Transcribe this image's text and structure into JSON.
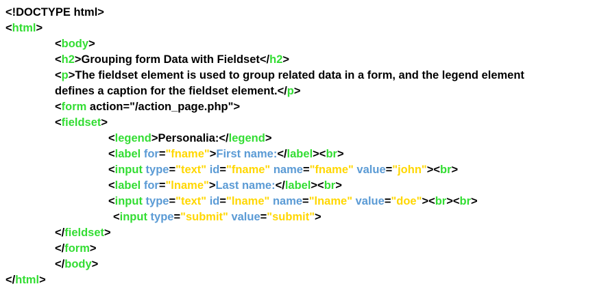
{
  "colors": {
    "text": "#000000",
    "tag": "#33dd33",
    "attr": "#5b9bd5",
    "value": "#ffd700"
  },
  "lines": [
    {
      "indent": 0,
      "tokens": [
        {
          "t": "<!DOCTYPE html>",
          "c": "text"
        }
      ]
    },
    {
      "indent": 0,
      "tokens": [
        {
          "t": "<",
          "c": "text"
        },
        {
          "t": "html",
          "c": "tag"
        },
        {
          "t": ">",
          "c": "text"
        }
      ]
    },
    {
      "indent": 1,
      "tokens": [
        {
          "t": "<",
          "c": "text"
        },
        {
          "t": "body",
          "c": "tag"
        },
        {
          "t": ">",
          "c": "text"
        }
      ]
    },
    {
      "indent": 1,
      "tokens": [
        {
          "t": "<",
          "c": "text"
        },
        {
          "t": "h2",
          "c": "tag"
        },
        {
          "t": ">Grouping form Data with Fieldset</",
          "c": "text"
        },
        {
          "t": "h2",
          "c": "tag"
        },
        {
          "t": ">",
          "c": "text"
        }
      ]
    },
    {
      "indent": 1,
      "tokens": [
        {
          "t": "<",
          "c": "text"
        },
        {
          "t": "p",
          "c": "tag"
        },
        {
          "t": ">The fieldset element is used to group related data in a form, and the legend element",
          "c": "text"
        }
      ]
    },
    {
      "indent": 1,
      "tokens": [
        {
          "t": "defines a caption for the fieldset element.</",
          "c": "text"
        },
        {
          "t": "p",
          "c": "tag"
        },
        {
          "t": ">",
          "c": "text"
        }
      ]
    },
    {
      "indent": 1,
      "tokens": [
        {
          "t": "<",
          "c": "text"
        },
        {
          "t": "form",
          "c": "tag"
        },
        {
          "t": " action=\"/action_page.php\">",
          "c": "text"
        }
      ]
    },
    {
      "indent": 1,
      "tokens": [
        {
          "t": "<",
          "c": "text"
        },
        {
          "t": "fieldset",
          "c": "tag"
        },
        {
          "t": ">",
          "c": "text"
        }
      ]
    },
    {
      "indent": 2,
      "tokens": [
        {
          "t": "<",
          "c": "text"
        },
        {
          "t": "legend",
          "c": "tag"
        },
        {
          "t": ">Personalia:</",
          "c": "text"
        },
        {
          "t": "legend",
          "c": "tag"
        },
        {
          "t": ">",
          "c": "text"
        }
      ]
    },
    {
      "indent": 2,
      "tokens": [
        {
          "t": "<",
          "c": "text"
        },
        {
          "t": "label",
          "c": "tag"
        },
        {
          "t": " for",
          "c": "attr"
        },
        {
          "t": "=",
          "c": "text"
        },
        {
          "t": "\"fname\"",
          "c": "val"
        },
        {
          "t": ">",
          "c": "text"
        },
        {
          "t": "First name:",
          "c": "attr"
        },
        {
          "t": "</",
          "c": "text"
        },
        {
          "t": "label",
          "c": "tag"
        },
        {
          "t": "><",
          "c": "text"
        },
        {
          "t": "br",
          "c": "tag"
        },
        {
          "t": ">",
          "c": "text"
        }
      ]
    },
    {
      "indent": 2,
      "tokens": [
        {
          "t": "<",
          "c": "text"
        },
        {
          "t": "input",
          "c": "tag"
        },
        {
          "t": " type",
          "c": "attr"
        },
        {
          "t": "=",
          "c": "text"
        },
        {
          "t": "\"text\"",
          "c": "val"
        },
        {
          "t": " id",
          "c": "attr"
        },
        {
          "t": "=",
          "c": "text"
        },
        {
          "t": "\"fname\"",
          "c": "val"
        },
        {
          "t": " name",
          "c": "attr"
        },
        {
          "t": "=",
          "c": "text"
        },
        {
          "t": "\"fname\"",
          "c": "val"
        },
        {
          "t": " value",
          "c": "attr"
        },
        {
          "t": "=",
          "c": "text"
        },
        {
          "t": "\"john\"",
          "c": "val"
        },
        {
          "t": "><",
          "c": "text"
        },
        {
          "t": "br",
          "c": "tag"
        },
        {
          "t": ">",
          "c": "text"
        }
      ]
    },
    {
      "indent": 2,
      "tokens": [
        {
          "t": "<",
          "c": "text"
        },
        {
          "t": "label",
          "c": "tag"
        },
        {
          "t": " for",
          "c": "attr"
        },
        {
          "t": "=",
          "c": "text"
        },
        {
          "t": "\"lname\"",
          "c": "val"
        },
        {
          "t": ">",
          "c": "text"
        },
        {
          "t": "Last name:",
          "c": "attr"
        },
        {
          "t": "</",
          "c": "text"
        },
        {
          "t": "label",
          "c": "tag"
        },
        {
          "t": "><",
          "c": "text"
        },
        {
          "t": "br",
          "c": "tag"
        },
        {
          "t": ">",
          "c": "text"
        }
      ]
    },
    {
      "indent": 2,
      "tokens": [
        {
          "t": "<",
          "c": "text"
        },
        {
          "t": "input",
          "c": "tag"
        },
        {
          "t": " type",
          "c": "attr"
        },
        {
          "t": "=",
          "c": "text"
        },
        {
          "t": "\"text\"",
          "c": "val"
        },
        {
          "t": " id",
          "c": "attr"
        },
        {
          "t": "=",
          "c": "text"
        },
        {
          "t": "\"lname\"",
          "c": "val"
        },
        {
          "t": " name",
          "c": "attr"
        },
        {
          "t": "=",
          "c": "text"
        },
        {
          "t": "\"lname\"",
          "c": "val"
        },
        {
          "t": " value",
          "c": "attr"
        },
        {
          "t": "=",
          "c": "text"
        },
        {
          "t": "\"doe\"",
          "c": "val"
        },
        {
          "t": "><",
          "c": "text"
        },
        {
          "t": "br",
          "c": "tag"
        },
        {
          "t": "><",
          "c": "text"
        },
        {
          "t": "br",
          "c": "tag"
        },
        {
          "t": ">",
          "c": "text"
        }
      ]
    },
    {
      "indent": 3,
      "tokens": [
        {
          "t": "<",
          "c": "text"
        },
        {
          "t": "input",
          "c": "tag"
        },
        {
          "t": " type",
          "c": "attr"
        },
        {
          "t": "=",
          "c": "text"
        },
        {
          "t": "\"submit\"",
          "c": "val"
        },
        {
          "t": " value",
          "c": "attr"
        },
        {
          "t": "=",
          "c": "text"
        },
        {
          "t": "\"submit\"",
          "c": "val"
        },
        {
          "t": ">",
          "c": "text"
        }
      ]
    },
    {
      "indent": 1,
      "tokens": [
        {
          "t": "</",
          "c": "text"
        },
        {
          "t": "fieldset",
          "c": "tag"
        },
        {
          "t": ">",
          "c": "text"
        }
      ]
    },
    {
      "indent": 1,
      "tokens": [
        {
          "t": "</",
          "c": "text"
        },
        {
          "t": "form",
          "c": "tag"
        },
        {
          "t": ">",
          "c": "text"
        }
      ]
    },
    {
      "indent": 1,
      "tokens": [
        {
          "t": "</",
          "c": "text"
        },
        {
          "t": "body",
          "c": "tag"
        },
        {
          "t": ">",
          "c": "text"
        }
      ]
    },
    {
      "indent": 0,
      "tokens": [
        {
          "t": "</",
          "c": "text"
        },
        {
          "t": "html",
          "c": "tag"
        },
        {
          "t": ">",
          "c": "text"
        }
      ]
    }
  ]
}
